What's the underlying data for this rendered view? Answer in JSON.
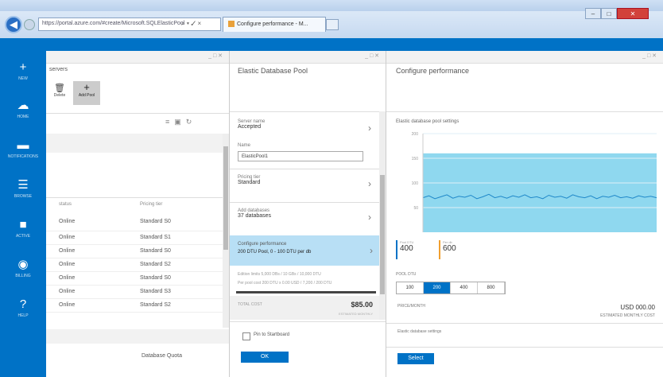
{
  "browser": {
    "address": "https://portal.azure.com/#create/Microsoft.SQLElasticPool",
    "address_controls": "⌕ ▾ ✓ ×",
    "tab_title": "Configure performance - M...",
    "win_min": "–",
    "win_max": "□",
    "win_close": "✕"
  },
  "nav": {
    "items": [
      {
        "label": "NEW",
        "icon": "+"
      },
      {
        "label": "HOME",
        "icon": "☁"
      },
      {
        "label": "NOTIFICATIONS",
        "icon": "▬"
      },
      {
        "label": "BROWSE",
        "icon": "☰"
      },
      {
        "label": "ACTIVE",
        "icon": "■"
      },
      {
        "label": "BILLING",
        "icon": "◉"
      },
      {
        "label": "HELP",
        "icon": "?"
      }
    ]
  },
  "blade1": {
    "header": "servers",
    "toolbar": [
      "Delete",
      "Add Pool"
    ],
    "mini_icons": [
      "≡",
      "▣",
      "↻"
    ],
    "col_status": "status",
    "col_tier": "Pricing tier",
    "rows": [
      {
        "status": "Online",
        "tier": "Standard S0"
      },
      {
        "status": "Online",
        "tier": "Standard S1"
      },
      {
        "status": "Online",
        "tier": "Standard S0"
      },
      {
        "status": "Online",
        "tier": "Standard S2"
      },
      {
        "status": "Online",
        "tier": "Standard S0"
      },
      {
        "status": "Online",
        "tier": "Standard S3"
      },
      {
        "status": "Online",
        "tier": "Standard S2"
      }
    ],
    "footer_label": "Database Quota"
  },
  "blade2": {
    "title": "Elastic Database Pool",
    "server_label": "Server name",
    "server_value": "Accepted",
    "name_label": "Name",
    "name_value": "ElasticPool1",
    "tier_label": "Pricing tier",
    "tier_value": "Standard",
    "dbs_label": "Add databases",
    "dbs_value": "37 databases",
    "perf_label": "Configure performance",
    "perf_value": "200 DTU Pool, 0 - 100 DTU per db",
    "info1_label": "Edition limits",
    "info1_value": "5,000 DBs / 10 GBs / 10,000 DTU",
    "info2_label": "Per pool cost",
    "info2_value": "200 DTU x 0.00 USD / 7,200 / 200 DTU",
    "total_label": "TOTAL COST",
    "total_value": "$85.00",
    "total_sub": "ESTIMATED MONTHLY",
    "pin_label": "Pin to Startboard",
    "create_label": "OK"
  },
  "blade3": {
    "title": "Configure performance",
    "chart_label": "Elastic database pool settings",
    "dtu_left_label": "Pool DTU",
    "dtu_left_value": "400",
    "dtu_right_label": "Per db",
    "dtu_right_value": "600",
    "pool_dtu_label": "POOL DTU",
    "pool_options": [
      "100",
      "200",
      "400",
      "800"
    ],
    "pool_selected": "200",
    "price_label": "PRICE/MONTH",
    "price_value": "USD 000.00",
    "price_sub": "ESTIMATED MONTHLY COST",
    "settings_label": "Elastic database settings",
    "select_label": "Select",
    "accent": "#0072c6",
    "chart_fill": "#8fd8ef"
  },
  "chart_data": {
    "type": "area",
    "title": "",
    "ylabel": "",
    "ylim": [
      0,
      200
    ],
    "y_ticks": [
      "200",
      "150",
      "100",
      "50"
    ],
    "x": [
      1,
      2,
      3,
      4,
      5,
      6,
      7,
      8,
      9,
      10,
      11,
      12,
      13,
      14,
      15,
      16,
      17,
      18,
      19,
      20,
      21,
      22,
      23,
      24,
      25,
      26,
      27,
      28,
      29,
      30,
      31,
      32,
      33,
      34,
      35,
      36,
      37,
      38,
      39,
      40
    ],
    "series": [
      {
        "values": [
          70,
          74,
          68,
          72,
          76,
          69,
          73,
          71,
          75,
          68,
          72,
          77,
          70,
          73,
          69,
          74,
          71,
          76,
          70,
          72,
          68,
          75,
          71,
          73,
          69,
          76,
          72,
          70,
          74,
          68,
          73,
          71,
          75,
          70,
          72,
          69,
          74,
          71,
          73,
          70
        ]
      }
    ],
    "band_top": 160
  }
}
